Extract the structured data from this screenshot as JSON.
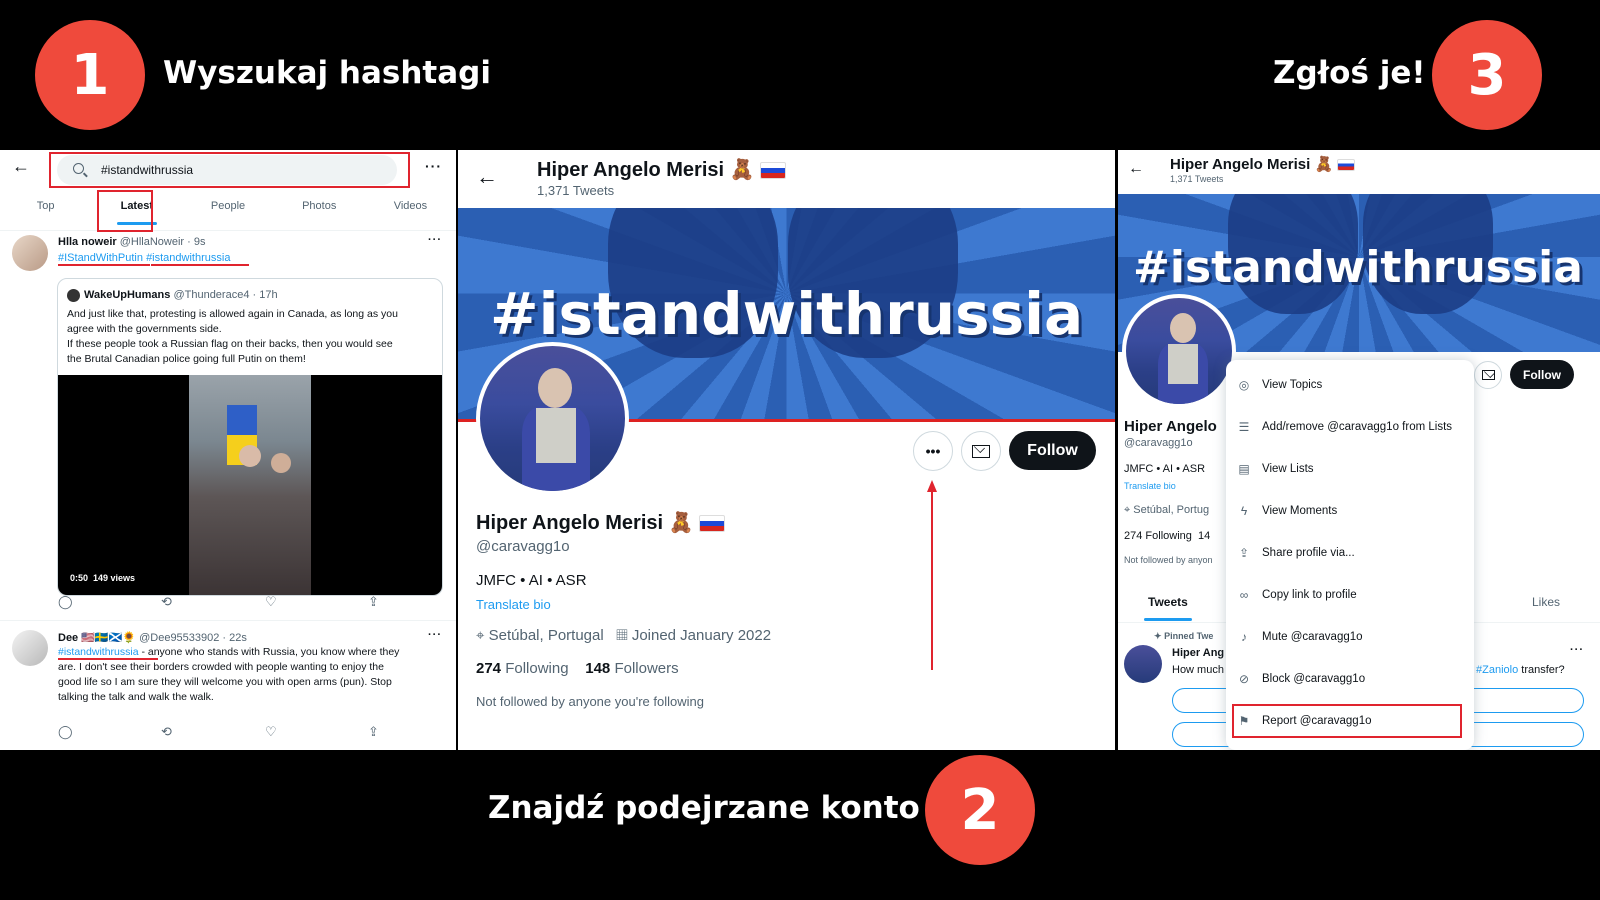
{
  "steps": [
    {
      "number": "1",
      "label": "Wyszukaj hashtagi"
    },
    {
      "number": "2",
      "label": "Znajdź podejrzane konto"
    },
    {
      "number": "3",
      "label": "Zgłoś je!"
    }
  ],
  "panel1": {
    "search_query": "#istandwithrussia",
    "tabs": [
      "Top",
      "Latest",
      "People",
      "Photos",
      "Videos"
    ],
    "tweet1": {
      "name": "Hlla noweir",
      "handle": "@HllaNoweir · 9s",
      "hashtag1": "#IStandWithPutin",
      "hashtag2": "#istandwithrussia",
      "quote_name": "WakeUpHumans",
      "quote_handle": "@Thunderace4 · 17h",
      "quote_text1": "And just like that, protesting is allowed again in Canada, as long as you",
      "quote_text2": "agree with the governments side.",
      "quote_text3": "If these people took a Russian flag on their backs, then you would see",
      "quote_text4": "the Brutal Canadian police going full Putin on them!",
      "video_time": "0:50",
      "video_views": "149 views"
    },
    "tweet2": {
      "name": "Dee 🇺🇸🇸🇪🏴󠁧󠁢󠁳󠁣󠁴󠁿🌻",
      "handle": "@Dee95533902 · 22s",
      "hashtag": "#istandwithrussia",
      "text1": " - anyone who stands with Russia, you know where they",
      "text2": "are.  I don't see their borders crowded with people wanting to enjoy the",
      "text3": "good life so I am sure they will welcome you with open arms (pun). Stop",
      "text4": "talking the talk and walk the walk."
    }
  },
  "panel2": {
    "header_name": "Hiper Angelo Merisi 🧸",
    "tweets_count": "1,371 Tweets",
    "banner_text": "#istandwithrussia",
    "follow_label": "Follow",
    "profile_name": "Hiper Angelo Merisi 🧸",
    "handle": "@caravagg1o",
    "bio": "JMFC • AI • ASR",
    "translate": "Translate bio",
    "location": "Setúbal, Portugal",
    "joined": "Joined January 2022",
    "following_count": "274",
    "following_label": "Following",
    "followers_count": "148",
    "followers_label": "Followers",
    "not_followed": "Not followed by anyone you're following"
  },
  "panel3": {
    "header_name": "Hiper Angelo Merisi 🧸",
    "tweets_count": "1,371 Tweets",
    "banner_text": "#istandwithrussia",
    "follow_label": "Follow",
    "profile_name": "Hiper Angelo",
    "handle": "@caravagg1o",
    "bio": "JMFC • AI • ASR",
    "translate": "Translate bio",
    "location": "Setúbal, Portug",
    "following": "274 Following",
    "followers_partial": "14",
    "not_followed": "Not followed by anyon",
    "tab_tweets": "Tweets",
    "tab_likes": "Likes",
    "pinned": "Pinned Twe",
    "pinned_name": "Hiper Ang",
    "pinned_text": "How much",
    "pinned_link": "#Zaniolo",
    "pinned_tail": " transfer?",
    "menu": [
      {
        "icon": "topics-icon",
        "label": "View Topics"
      },
      {
        "icon": "list-add-icon",
        "label": "Add/remove @caravagg1o from Lists"
      },
      {
        "icon": "lists-icon",
        "label": "View Lists"
      },
      {
        "icon": "moments-icon",
        "label": "View Moments"
      },
      {
        "icon": "share-icon",
        "label": "Share profile via..."
      },
      {
        "icon": "link-icon",
        "label": "Copy link to profile"
      },
      {
        "icon": "mute-icon",
        "label": "Mute @caravagg1o"
      },
      {
        "icon": "block-icon",
        "label": "Block @caravagg1o"
      },
      {
        "icon": "report-icon",
        "label": "Report @caravagg1o"
      }
    ]
  },
  "colors": {
    "accent": "#ef4a3c",
    "twitter_blue": "#1d9bf0",
    "highlight": "#e0242e"
  }
}
